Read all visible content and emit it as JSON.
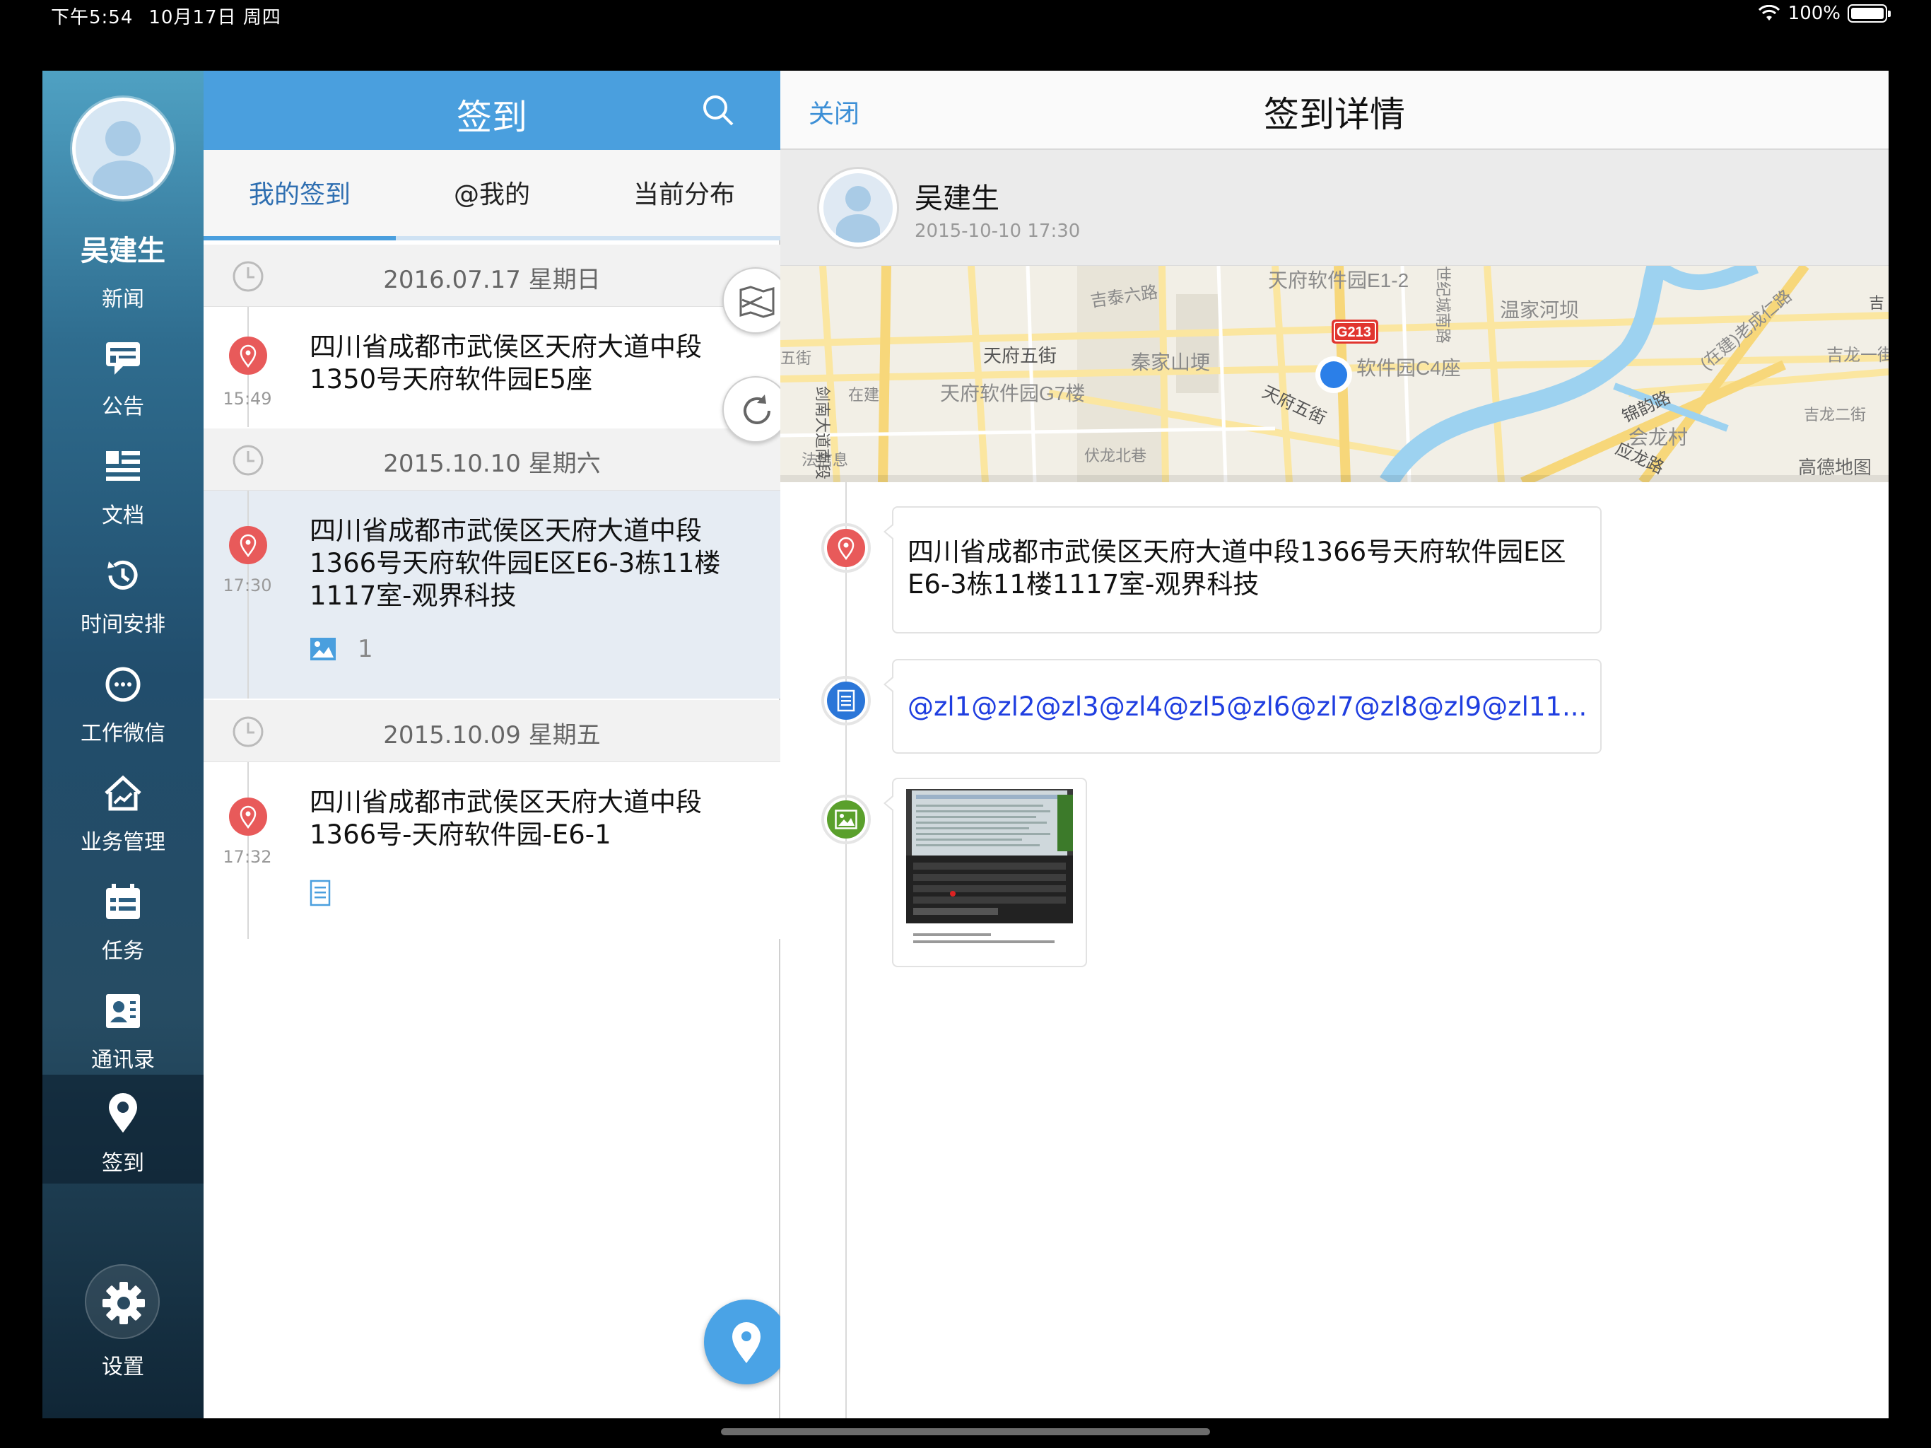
{
  "status_bar": {
    "time": "下午5:54",
    "date": "10月17日 周四",
    "battery": "100%"
  },
  "sidebar": {
    "user_name": "吴建生",
    "news_label": "新闻",
    "items": [
      {
        "label": "公告",
        "icon": "announcement-icon"
      },
      {
        "label": "文档",
        "icon": "document-icon"
      },
      {
        "label": "时间安排",
        "icon": "history-clock-icon"
      },
      {
        "label": "工作微信",
        "icon": "chat-bubble-icon"
      },
      {
        "label": "业务管理",
        "icon": "house-chart-icon"
      },
      {
        "label": "任务",
        "icon": "calendar-icon"
      },
      {
        "label": "通讯录",
        "icon": "contacts-icon"
      },
      {
        "label": "签到",
        "icon": "location-pin-icon",
        "active": true
      }
    ],
    "settings_label": "设置"
  },
  "list": {
    "title": "签到",
    "tabs": [
      "我的签到",
      "@我的",
      "当前分布"
    ],
    "active_tab": 0,
    "groups": [
      {
        "date": "2016.07.17 星期日",
        "entry": {
          "time": "15:49",
          "address": "四川省成都市武侯区天府大道中段1350号天府软件园E5座"
        }
      },
      {
        "date": "2015.10.10 星期六",
        "entry": {
          "time": "17:30",
          "address": "四川省成都市武侯区天府大道中段1366号天府软件园E区E6-3栋11楼1117室-观界科技",
          "image_count": "1",
          "selected": true
        }
      },
      {
        "date": "2015.10.09 星期五",
        "entry": {
          "time": "17:32",
          "address": "四川省成都市武侯区天府大道中段1366号-天府软件园-E6-1",
          "has_note": true
        }
      }
    ]
  },
  "detail": {
    "close_label": "关闭",
    "title": "签到详情",
    "user_name": "吴建生",
    "timestamp": "2015-10-10 17:30",
    "map": {
      "labels": [
        "天府软件园E1-2",
        "吉泰六路",
        "温家河坝",
        "(在建)老成仁路",
        "吉龙一街",
        "G213",
        "天府五街",
        "秦家山埂",
        "软件园C4座",
        "天府软件园G7楼",
        "在建",
        "天府五街",
        "锦韵路",
        "吉龙二街",
        "会龙村",
        "应龙路",
        "高德地图",
        "伏龙北巷",
        "法信息",
        "剑南大道南段",
        "五街",
        "世纪城南路",
        "吉"
      ]
    },
    "address": "四川省成都市武侯区天府大道中段1366号天府软件园E区E6-3栋11楼1117室-观界科技",
    "mentions": "@zl1@zl2@zl3@zl4@zl5@zl6@zl7@zl8@zl9@zl11..."
  },
  "colors": {
    "header_blue": "#4a9fde",
    "pin_red": "#e85a5a",
    "note_blue": "#2b76d8",
    "image_green": "#5aa02c",
    "mention_blue": "#1f3ee0"
  }
}
